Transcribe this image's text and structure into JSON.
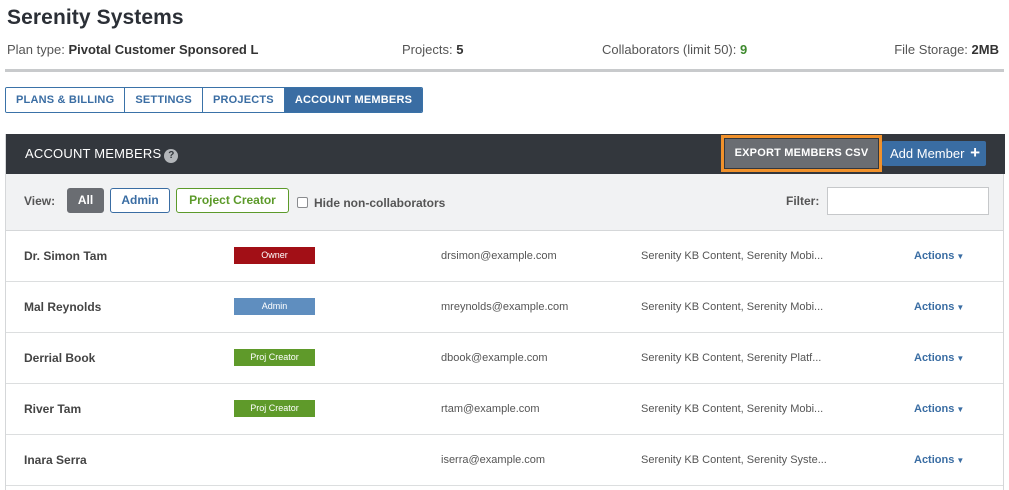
{
  "account": {
    "title": "Serenity Systems",
    "plan_label": "Plan type:",
    "plan_value": "Pivotal Customer Sponsored L",
    "projects_label": "Projects:",
    "projects_value": "5",
    "collaborators_label": "Collaborators (limit 50):",
    "collaborators_value": "9",
    "storage_label": "File Storage:",
    "storage_value": "2MB"
  },
  "tabs": [
    {
      "label": "PLANS & BILLING",
      "active": false
    },
    {
      "label": "SETTINGS",
      "active": false
    },
    {
      "label": "PROJECTS",
      "active": false
    },
    {
      "label": "ACCOUNT MEMBERS",
      "active": true
    }
  ],
  "panel": {
    "title": "ACCOUNT MEMBERS",
    "help_glyph": "?",
    "export_label": "EXPORT MEMBERS CSV",
    "add_label": "Add Member",
    "add_glyph": "+"
  },
  "filters": {
    "view_label": "View:",
    "all_label": "All",
    "admin_label": "Admin",
    "creator_label": "Project Creator",
    "hide_label": "Hide non-collaborators",
    "filter_label": "Filter:",
    "filter_value": ""
  },
  "members": [
    {
      "name": "Dr. Simon Tam",
      "role": "Owner",
      "email": "drsimon@example.com",
      "projects": "Serenity KB Content, Serenity Mobi...",
      "actions": "Actions"
    },
    {
      "name": "Mal Reynolds",
      "role": "Admin",
      "email": "mreynolds@example.com",
      "projects": "Serenity KB Content, Serenity Mobi...",
      "actions": "Actions"
    },
    {
      "name": "Derrial Book",
      "role": "Proj Creator",
      "email": "dbook@example.com",
      "projects": "Serenity KB Content, Serenity Platf...",
      "actions": "Actions"
    },
    {
      "name": "River Tam",
      "role": "Proj Creator",
      "email": "rtam@example.com",
      "projects": "Serenity KB Content, Serenity Mobi...",
      "actions": "Actions"
    },
    {
      "name": "Inara Serra",
      "role": "",
      "email": "iserra@example.com",
      "projects": "Serenity KB Content, Serenity Syste...",
      "actions": "Actions"
    }
  ],
  "caret_glyph": "▼",
  "colors": {
    "accent": "#3a6da3",
    "header_bg": "#33373d",
    "export_highlight": "#f0912b",
    "owner_badge": "#a20f16",
    "admin_badge": "#5f8ebf",
    "creator_badge": "#5f9a2a"
  }
}
